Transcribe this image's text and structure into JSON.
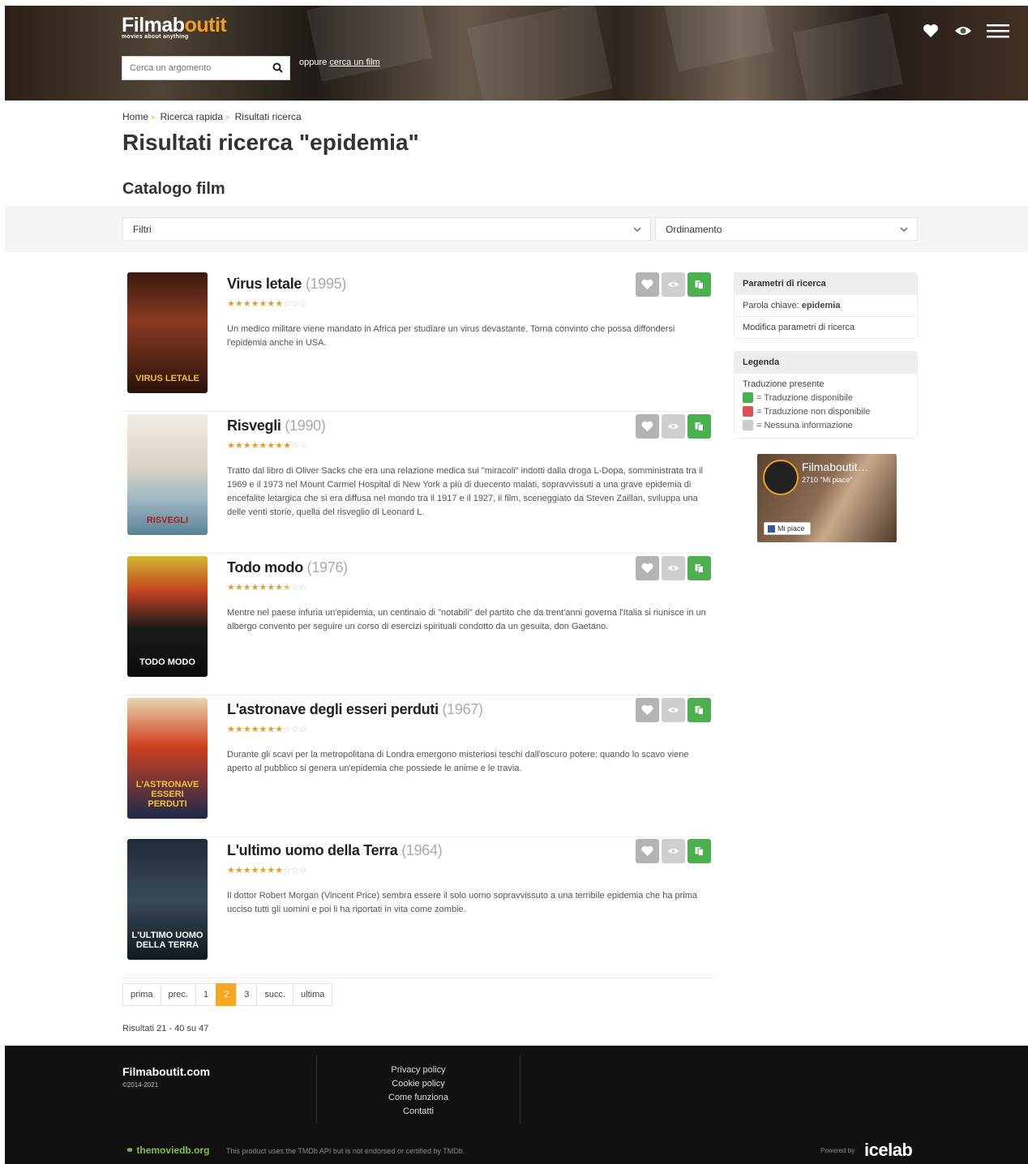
{
  "header": {
    "logo_main": "Filmab",
    "logo_accent": "outit",
    "tagline": "movies about anything",
    "search_placeholder": "Cerca un argomento",
    "or_text": "oppure",
    "search_film_link": "cerca un film"
  },
  "breadcrumb": [
    "Home",
    "Ricerca rapida",
    "Risultati ricerca"
  ],
  "page_title": "Risultati ricerca \"epidemia\"",
  "section_title": "Catalogo film",
  "filters": {
    "filter_label": "Filtri",
    "sort_label": "Ordinamento"
  },
  "results": [
    {
      "title": "Virus letale",
      "year": "(1995)",
      "rating": 7,
      "description": "Un medico militare viene mandato in Africa per studiare un virus devastante. Torna convinto che possa diffondersi l'epidemia anche in USA."
    },
    {
      "title": "Risvegli",
      "year": "(1990)",
      "rating": 8,
      "description": "Tratto dal libro di Oliver Sacks che era una relazione medica sui \"miracoli\" indotti dalla droga L-Dopa, somministrata tra il 1969 e il 1973 nel Mount Carmel Hospital di New York a più di duecento malati, sopravvissuti a una grave epidemia di encefalite letargica che si era diffusa nel mondo tra il 1917 e il 1927, il film, sceneggiato da Steven Zaillan, sviluppa una delle venti storie, quella del risveglio di Leonard L."
    },
    {
      "title": "Todo modo",
      "year": "(1976)",
      "rating": 7.5,
      "description": "Mentre nel paese infuria un'epidemia, un centinaio di \"notabili\" del partito che da trent'anni governa l'Italia si riunisce in un albergo convento per seguire un corso di esercizi spirituali condotto da un gesuita, don Gaetano."
    },
    {
      "title": "L'astronave degli esseri perduti",
      "year": "(1967)",
      "rating": 7,
      "description": "Durante gli scavi per la metropolitana di Londra emergono misteriosi teschi dall'oscuro potere: quando lo scavo viene aperto al pubblico si genera un'epidemia che possiede le anime e le travia."
    },
    {
      "title": "L'ultimo uomo della Terra",
      "year": "(1964)",
      "rating": 7,
      "description": "Il dottor Robert Morgan (Vincent Price) sembra essere il solo uomo sopravvissuto a una terribile epidemia che ha prima ucciso tutti gli uomini e poi li ha riportati in vita come zombie."
    }
  ],
  "posters": {
    "p1": "VIRUS LETALE",
    "p2": "RISVEGLI",
    "p3": "TODO MODO",
    "p4": "L'ASTRONAVE ESSERI PERDUTI",
    "p5": "L'ULTIMO UOMO DELLA TERRA"
  },
  "sidebar": {
    "params_title": "Parametri di ricerca",
    "keyword_label": "Parola chiave:",
    "keyword_value": "epidemia",
    "modify_link": "Modifica parametri di ricerca",
    "legend_title": "Legenda",
    "legend_subtitle": "Traduzione presente",
    "legend_available": "= Traduzione disponibile",
    "legend_unavailable": "= Traduzione non disponibile",
    "legend_none": "= Nessuna informazione",
    "fb_name": "Filmaboutit…",
    "fb_likes": "2710 \"Mi piace\"",
    "fb_button": "Mi piace"
  },
  "pagination": [
    "prima",
    "prec.",
    "1",
    "2",
    "3",
    "succ.",
    "ultima"
  ],
  "pagination_active": "2",
  "results_count": "Risultati 21 - 40 su 47",
  "footer": {
    "brand": "Filmaboutit.com",
    "copyright": "©2014-2021",
    "links": [
      "Privacy policy",
      "Cookie policy",
      "Come funziona",
      "Contatti"
    ],
    "tmdb": "themoviedb.org",
    "tmdb_note": "This product uses the TMDb API but is not endorsed or certified by TMDb.",
    "powered_by": "Powered by",
    "icelab": "icelab"
  },
  "colors": {
    "accent": "#f5a623",
    "star": "#e0a030",
    "translation_available": "#4caf50",
    "translation_unavailable": "#e05050",
    "no_info": "#cccccc"
  }
}
